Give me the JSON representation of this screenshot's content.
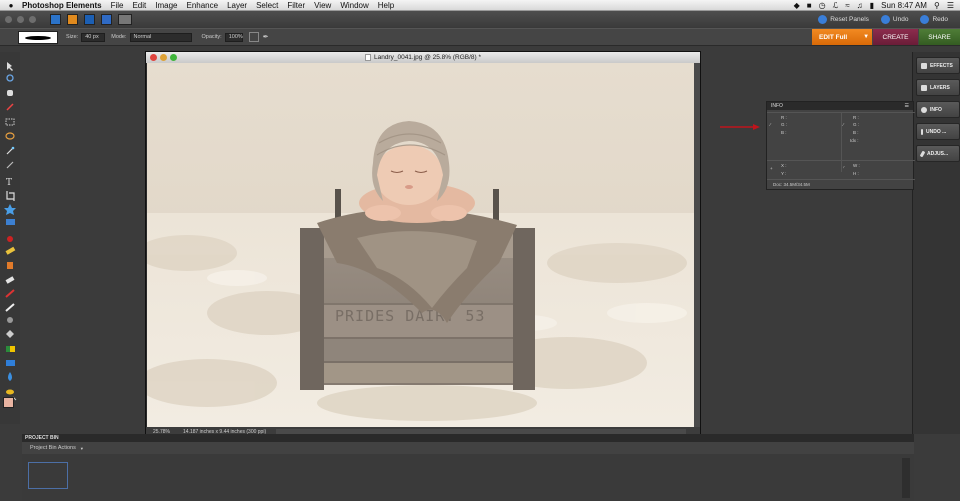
{
  "menubar": {
    "app_name": "Photoshop Elements",
    "items": [
      "File",
      "Edit",
      "Image",
      "Enhance",
      "Layer",
      "Select",
      "Filter",
      "View",
      "Window",
      "Help"
    ],
    "clock": "Sun 8:47 AM"
  },
  "topbar": {
    "reset_panels": "Reset Panels",
    "undo": "Undo",
    "redo": "Redo"
  },
  "options": {
    "size_label": "Size:",
    "size_value": "40 px",
    "mode_label": "Mode:",
    "mode_value": "Normal",
    "opacity_label": "Opacity:",
    "opacity_value": "100%"
  },
  "workspace": {
    "edit_label": "EDIT Full",
    "create_label": "CREATE",
    "share_label": "SHARE"
  },
  "panels": {
    "items": [
      "EFFECTS",
      "LAYERS",
      "INFO",
      "UNDO ...",
      "ADJUS..."
    ]
  },
  "document": {
    "title": "Landry_0041.jpg @ 25.8% (RGB/8) *",
    "zoom": "25.78%",
    "dimensions": "14.187 inches x 9.44 inches (300 ppi)",
    "crate_text": "PRIDES DAIRY 53"
  },
  "info_panel": {
    "title": "INFO",
    "r": "R :",
    "g": "G :",
    "b": "B :",
    "idx": "Idx :",
    "x": "X :",
    "y": "Y :",
    "w": "W :",
    "h": "H :",
    "doc": "Doc: 34.5M/34.5M"
  },
  "project_bin": {
    "title": "PROJECT BIN",
    "actions": "Project Bin Actions"
  },
  "colors": {
    "edit_orange": "#e57b14",
    "create_plum": "#7b2444",
    "share_green": "#427030",
    "arrow_red": "#c0141c",
    "fg_swatch": "#e8b3a1"
  }
}
